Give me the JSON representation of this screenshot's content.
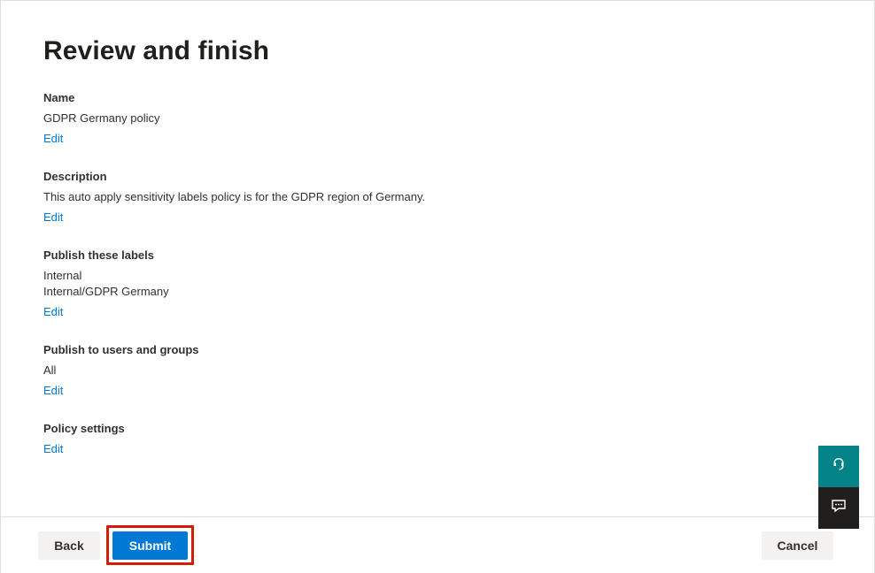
{
  "page": {
    "title": "Review and finish"
  },
  "sections": [
    {
      "heading": "Name",
      "values": [
        "GDPR Germany policy"
      ],
      "edit_label": "Edit"
    },
    {
      "heading": "Description",
      "values": [
        "This auto apply sensitivity labels policy is for the GDPR region of Germany."
      ],
      "edit_label": "Edit"
    },
    {
      "heading": "Publish these labels",
      "values": [
        "Internal",
        "Internal/GDPR Germany"
      ],
      "edit_label": "Edit"
    },
    {
      "heading": "Publish to users and groups",
      "values": [
        "All"
      ],
      "edit_label": "Edit"
    },
    {
      "heading": "Policy settings",
      "values": [],
      "edit_label": "Edit"
    }
  ],
  "footer": {
    "back_label": "Back",
    "submit_label": "Submit",
    "cancel_label": "Cancel"
  },
  "side_actions": {
    "help_icon": "headset-icon",
    "feedback_icon": "feedback-icon"
  },
  "colors": {
    "accent": "#0078d4",
    "highlight": "#d41c00",
    "help_bg": "#038387",
    "feedback_bg": "#201f1e"
  }
}
